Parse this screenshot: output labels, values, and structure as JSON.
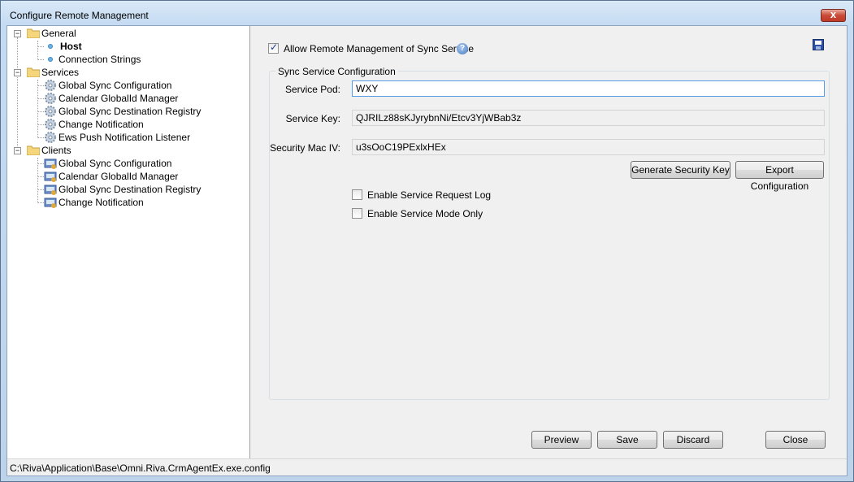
{
  "window": {
    "title": "Configure Remote Management",
    "close_symbol": "x",
    "close_icon": "close-icon"
  },
  "tree": {
    "groups": [
      {
        "label": "General",
        "icon": "folder-icon",
        "expander": "−",
        "items": [
          {
            "label": "Host",
            "icon": "bullet-icon",
            "selected": true
          },
          {
            "label": "Connection Strings",
            "icon": "bullet-icon"
          }
        ]
      },
      {
        "label": "Services",
        "icon": "folder-icon",
        "expander": "−",
        "items": [
          {
            "label": "Global Sync Configuration",
            "icon": "gear-icon"
          },
          {
            "label": "Calendar GlobalId Manager",
            "icon": "gear-icon"
          },
          {
            "label": "Global Sync Destination Registry",
            "icon": "gear-icon"
          },
          {
            "label": "Change Notification",
            "icon": "gear-icon"
          },
          {
            "label": "Ews Push Notification Listener",
            "icon": "gear-icon"
          }
        ]
      },
      {
        "label": "Clients",
        "icon": "folder-icon",
        "expander": "−",
        "items": [
          {
            "label": "Global Sync Configuration",
            "icon": "client-icon"
          },
          {
            "label": "Calendar GlobalId Manager",
            "icon": "client-icon"
          },
          {
            "label": "Global Sync Destination Registry",
            "icon": "client-icon"
          },
          {
            "label": "Change Notification",
            "icon": "client-icon"
          }
        ]
      }
    ]
  },
  "main": {
    "allow_remote": {
      "label": "Allow Remote Management of Sync Service",
      "checked": true,
      "help_icon": "help-icon",
      "help_symbol": "?"
    },
    "save_icon": "save-icon",
    "group": {
      "title": "Sync Service Configuration",
      "service_pod": {
        "label": "Service Pod:",
        "value": "WXY"
      },
      "service_key": {
        "label": "Service Key:",
        "value": "QJRILz88sKJyrybnNi/Etcv3YjWBab3z"
      },
      "security_mac_iv": {
        "label": "Security Mac IV:",
        "value": "u3sOoC19PExlxHEx"
      },
      "generate_button": "Generate Security Key",
      "export_button": "Export Configuration",
      "enable_request_log": {
        "label": "Enable Service Request Log",
        "checked": false
      },
      "enable_service_mode": {
        "label": "Enable Service Mode Only",
        "checked": false
      }
    },
    "buttons": {
      "preview": "Preview",
      "save": "Save",
      "discard": "Discard",
      "close": "Close"
    }
  },
  "statusbar": {
    "path": "C:\\Riva\\Application\\Base\\Omni.Riva.CrmAgentEx.exe.config"
  }
}
